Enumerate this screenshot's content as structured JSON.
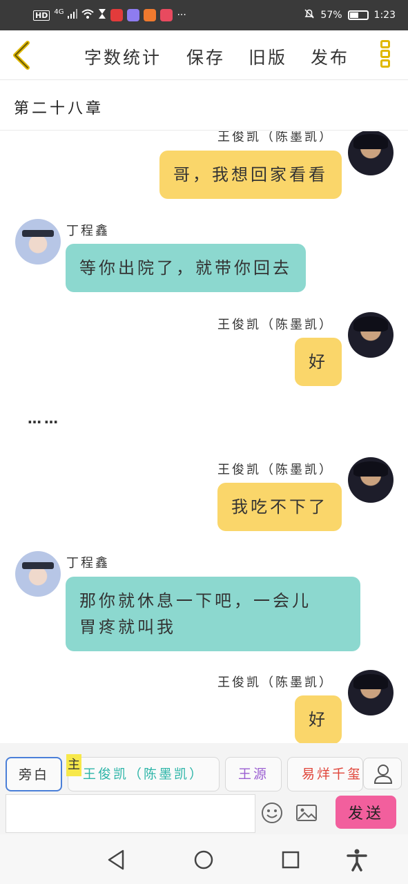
{
  "status_bar": {
    "hd": "HD",
    "signal": "4G",
    "more": "···",
    "battery_text": "57%",
    "battery_level": 0.57,
    "time": "1:23",
    "app_icon_colors": [
      "#e33b3b",
      "#8e7cf0",
      "#f07a2e",
      "#e84a5f"
    ]
  },
  "toolbar": {
    "back_icon": "chevron-left-icon",
    "word_count": "字数统计",
    "save": "保存",
    "old_version": "旧版",
    "publish": "发布",
    "menu_icon": "more-vertical-icon",
    "accent": "#e0b800"
  },
  "chapter": {
    "title": "第二十八章"
  },
  "chat": {
    "messages": [
      {
        "side": "right",
        "sender": "王俊凯（陈墨凯）",
        "text": "哥，我想回家看看",
        "color": "#fad66a"
      },
      {
        "side": "left",
        "sender": "丁程鑫",
        "text": "等你出院了，就带你回去",
        "color": "#8cd8cf"
      },
      {
        "side": "right",
        "sender": "王俊凯（陈墨凯）",
        "text": "好",
        "color": "#fad66a"
      },
      {
        "side": "narration",
        "text": "……"
      },
      {
        "side": "right",
        "sender": "王俊凯（陈墨凯）",
        "text": "我吃不下了",
        "color": "#fad66a"
      },
      {
        "side": "left",
        "sender": "丁程鑫",
        "text_line1": "那你就休息一下吧，一会儿",
        "text_line2": "胃疼就叫我",
        "color": "#8cd8cf"
      },
      {
        "side": "right",
        "sender": "王俊凯（陈墨凯）",
        "text": "好",
        "color": "#fad66a"
      }
    ]
  },
  "roles": {
    "main_badge": "主",
    "items": [
      {
        "label": "旁白",
        "color": "#333333",
        "selected": true
      },
      {
        "label": "王俊凯（陈墨凯）",
        "color": "#2db5a8"
      },
      {
        "label": "王源",
        "color": "#9b5fd1"
      },
      {
        "label": "易烊千玺",
        "color": "#e0453a"
      }
    ],
    "user_icon": "user-icon"
  },
  "composer": {
    "input_value": "",
    "input_placeholder": "",
    "emoji_icon": "emoji-icon",
    "image_icon": "image-icon",
    "send": "发送",
    "send_color": "#f25f9d"
  },
  "nav": {
    "back": "back-triangle-icon",
    "home": "home-circle-icon",
    "recents": "recents-square-icon",
    "accessibility": "accessibility-icon"
  }
}
